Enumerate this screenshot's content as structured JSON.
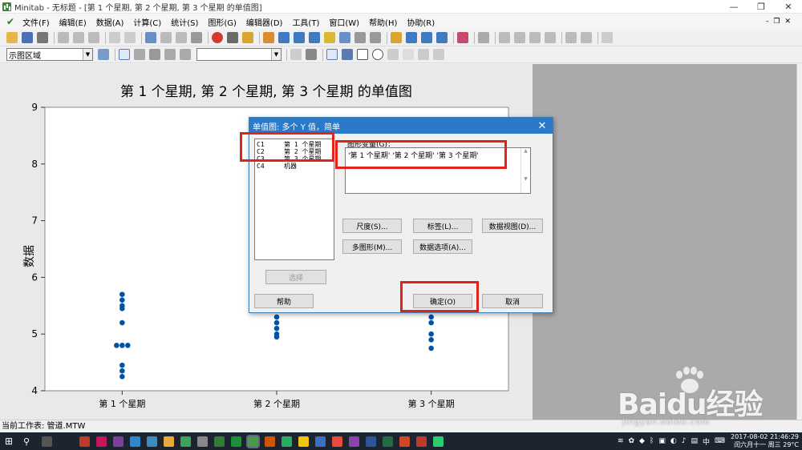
{
  "window": {
    "title": "Minitab - 无标题 - [第 1 个星期, 第 2 个星期, 第 3 个星期 的单值图]",
    "minimize": "—",
    "maximize": "❐",
    "close": "✕"
  },
  "menu": {
    "items": [
      "文件(F)",
      "编辑(E)",
      "数据(A)",
      "计算(C)",
      "统计(S)",
      "图形(G)",
      "编辑器(D)",
      "工具(T)",
      "窗口(W)",
      "帮助(H)",
      "协助(R)"
    ],
    "mdi_buttons": [
      "-",
      "❐",
      "✕"
    ]
  },
  "toolbar2": {
    "region_combo": "示图区域",
    "font_combo": ""
  },
  "graph": {
    "title": "第 1 个星期, 第 2 个星期, 第 3 个星期 的单值图",
    "ylabel": "数据"
  },
  "chart_data": {
    "type": "scatter",
    "title": "第 1 个星期, 第 2 个星期, 第 3 个星期 的单值图",
    "xlabel": "",
    "ylabel": "数据",
    "categories": [
      "第 1 个星期",
      "第 2 个星期",
      "第 3 个星期"
    ],
    "ylim": [
      4,
      9
    ],
    "yticks": [
      4,
      5,
      6,
      7,
      8,
      9
    ],
    "grid": false,
    "series": [
      {
        "category": "第 1 个星期",
        "values": [
          5.7,
          5.6,
          5.5,
          5.45,
          5.2,
          4.8,
          4.8,
          4.8,
          4.45,
          4.35,
          4.25
        ],
        "offsets": [
          0,
          0,
          0,
          0,
          0,
          -1,
          0,
          1,
          0,
          0,
          0
        ]
      },
      {
        "category": "第 2 个星期",
        "values": [
          5.3,
          5.2,
          5.1,
          5.0,
          4.95
        ],
        "offsets": [
          0,
          0,
          0,
          0,
          0
        ]
      },
      {
        "category": "第 3 个星期",
        "values": [
          5.3,
          5.2,
          5.0,
          4.9,
          4.75
        ],
        "offsets": [
          0,
          0,
          0,
          0,
          0
        ]
      }
    ]
  },
  "dialog": {
    "title": "单值图: 多个 Y 值，简单",
    "close": "✕",
    "variables": [
      {
        "col": "C1",
        "name": "第 1 个星期"
      },
      {
        "col": "C2",
        "name": "第 2 个星期"
      },
      {
        "col": "C3",
        "name": "第 3 个星期"
      },
      {
        "col": "C4",
        "name": "机器"
      }
    ],
    "graph_vars_label": "图形变量(G)：",
    "graph_vars_value": "'第 1 个星期' '第 2 个星期' '第 3 个星期'",
    "buttons": {
      "scale": "尺度(S)...",
      "labels": "标签(L)...",
      "data_view": "数据视图(D)...",
      "multi_graph": "多图形(M)...",
      "data_options": "数据选项(A)...",
      "select": "选择",
      "help": "帮助",
      "ok": "确定(O)",
      "cancel": "取消"
    }
  },
  "statusbar": {
    "text": "当前工作表: 管道.MTW"
  },
  "taskbar": {
    "start_icon": "windows-logo",
    "time": "21:46:29",
    "date": "2017-08-02",
    "lunar": "闰六月十一 周三 29°C",
    "ime": "中"
  },
  "watermark": {
    "main": "Baidu经验",
    "sub": "jingyan.baidu.com"
  },
  "colors": {
    "accent": "#2b79c9",
    "dot": "#0054a6",
    "annotation": "#e0231b"
  }
}
